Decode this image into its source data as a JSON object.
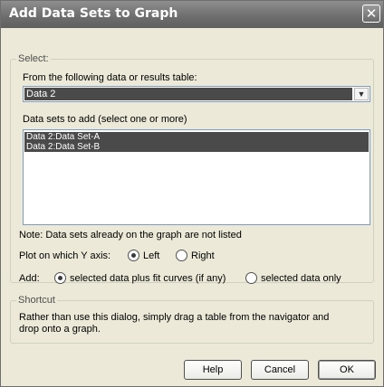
{
  "window": {
    "title": "Add Data Sets to Graph",
    "close_glyph": "✕"
  },
  "select_group": {
    "legend": "Select:",
    "table_label": "From the following data or results table:",
    "table_selected": "Data 2",
    "datasets_label": "Data sets to add (select one or more)",
    "datasets": [
      "Data 2:Data Set-A",
      "Data 2:Data Set-B"
    ]
  },
  "note": "Note: Data sets already on the graph are not listed",
  "yaxis": {
    "label": "Plot on which Y axis:",
    "options": [
      "Left",
      "Right"
    ],
    "selected": "Left"
  },
  "add": {
    "label": "Add:",
    "options": [
      "selected data plus fit curves (if any)",
      "selected data only"
    ],
    "selected": "selected data plus fit curves (if any)"
  },
  "shortcut": {
    "legend": "Shortcut",
    "line1": "Rather than use this dialog, simply drag a table from the navigator and",
    "line2": "drop onto a graph."
  },
  "buttons": {
    "help": "Help",
    "cancel": "Cancel",
    "ok": "OK"
  }
}
